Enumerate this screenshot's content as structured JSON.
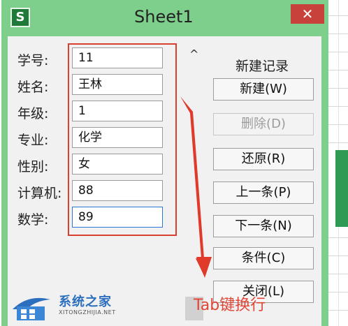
{
  "window": {
    "title": "Sheet1",
    "app_icon_glyph": "S",
    "close_glyph": "✕",
    "accent_color": "#7fcf8c"
  },
  "form": {
    "fields": [
      {
        "label": "学号:",
        "value": "11"
      },
      {
        "label": "姓名:",
        "value": "王林"
      },
      {
        "label": "年级:",
        "value": "1"
      },
      {
        "label": "专业:",
        "value": "化学"
      },
      {
        "label": "性别:",
        "value": "女"
      },
      {
        "label": "计算机:",
        "value": "88"
      },
      {
        "label": "数学:",
        "value": "89"
      }
    ]
  },
  "side": {
    "scroll_glyph": "^",
    "record_title": "新建记录",
    "buttons": [
      {
        "label": "新建(W)",
        "enabled": true
      },
      {
        "label": "删除(D)",
        "enabled": false
      },
      {
        "label": "还原(R)",
        "enabled": true
      },
      {
        "label": "上一条(P)",
        "enabled": true
      },
      {
        "label": "下一条(N)",
        "enabled": true
      },
      {
        "label": "条件(C)",
        "enabled": true
      },
      {
        "label": "关闭(L)",
        "enabled": true
      }
    ]
  },
  "annotation": {
    "text": "Tab键换行",
    "color": "#e14535"
  },
  "watermark": {
    "name": "系统之家",
    "url": "XITONGZHIJIA.NET"
  }
}
